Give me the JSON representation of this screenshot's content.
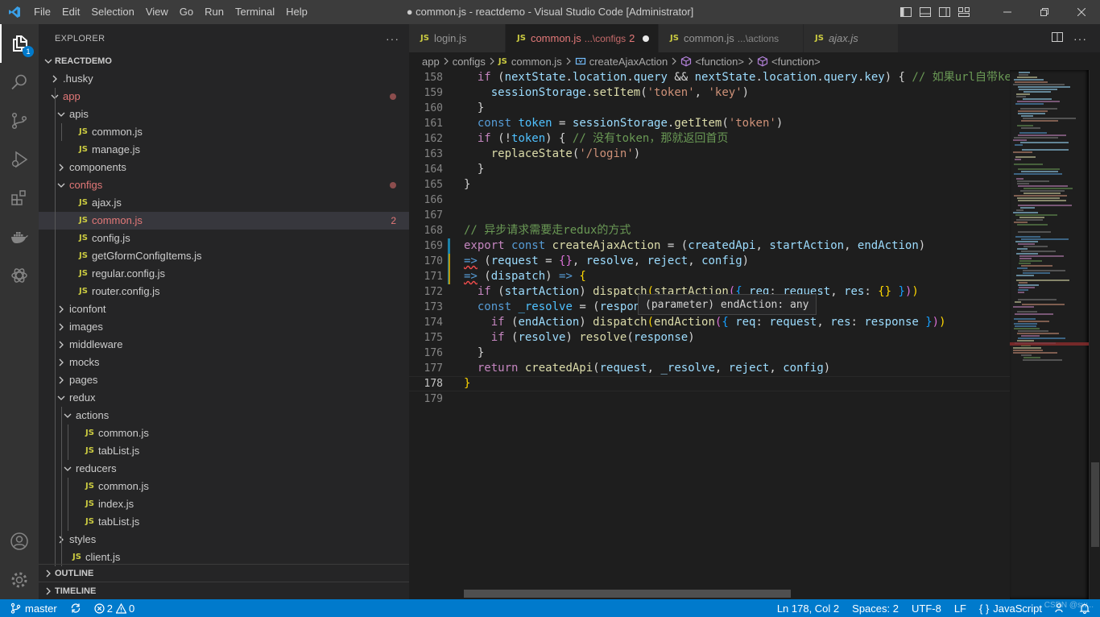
{
  "window": {
    "title": "● common.js - reactdemo - Visual Studio Code [Administrator]",
    "menu": [
      "File",
      "Edit",
      "Selection",
      "View",
      "Go",
      "Run",
      "Terminal",
      "Help"
    ]
  },
  "activity": {
    "explorer_badge": "1",
    "icons": [
      "files-icon",
      "search-icon",
      "source-control-icon",
      "run-debug-icon",
      "extensions-icon",
      "docker-icon",
      "openai-icon"
    ],
    "bottom_icons": [
      "account-icon",
      "settings-gear-icon"
    ]
  },
  "sidebar": {
    "header": "EXPLORER",
    "more": "···",
    "root": "REACTDEMO",
    "tree": [
      {
        "label": ".husky",
        "type": "folder",
        "open": false,
        "depth": 1
      },
      {
        "label": "app",
        "type": "folder",
        "open": true,
        "depth": 1,
        "modified": true
      },
      {
        "label": "apis",
        "type": "folder",
        "open": true,
        "depth": 2
      },
      {
        "label": "common.js",
        "type": "file",
        "depth": 3
      },
      {
        "label": "manage.js",
        "type": "file",
        "depth": 3
      },
      {
        "label": "components",
        "type": "folder",
        "open": false,
        "depth": 2
      },
      {
        "label": "configs",
        "type": "folder",
        "open": true,
        "depth": 2,
        "modified": true
      },
      {
        "label": "ajax.js",
        "type": "file",
        "depth": 3
      },
      {
        "label": "common.js",
        "type": "file",
        "depth": 3,
        "selected": true,
        "problems": "2"
      },
      {
        "label": "config.js",
        "type": "file",
        "depth": 3
      },
      {
        "label": "getGformConfigItems.js",
        "type": "file",
        "depth": 3
      },
      {
        "label": "regular.config.js",
        "type": "file",
        "depth": 3
      },
      {
        "label": "router.config.js",
        "type": "file",
        "depth": 3
      },
      {
        "label": "iconfont",
        "type": "folder",
        "open": false,
        "depth": 2
      },
      {
        "label": "images",
        "type": "folder",
        "open": false,
        "depth": 2
      },
      {
        "label": "middleware",
        "type": "folder",
        "open": false,
        "depth": 2
      },
      {
        "label": "mocks",
        "type": "folder",
        "open": false,
        "depth": 2
      },
      {
        "label": "pages",
        "type": "folder",
        "open": false,
        "depth": 2
      },
      {
        "label": "redux",
        "type": "folder",
        "open": true,
        "depth": 2
      },
      {
        "label": "actions",
        "type": "folder",
        "open": true,
        "depth": 3
      },
      {
        "label": "common.js",
        "type": "file",
        "depth": 4
      },
      {
        "label": "tabList.js",
        "type": "file",
        "depth": 4
      },
      {
        "label": "reducers",
        "type": "folder",
        "open": true,
        "depth": 3
      },
      {
        "label": "common.js",
        "type": "file",
        "depth": 4
      },
      {
        "label": "index.js",
        "type": "file",
        "depth": 4
      },
      {
        "label": "tabList.js",
        "type": "file",
        "depth": 4
      },
      {
        "label": "styles",
        "type": "folder",
        "open": false,
        "depth": 2
      },
      {
        "label": "client.js",
        "type": "file",
        "depth": 2
      }
    ],
    "file_icon_text": "JS",
    "outline": "OUTLINE",
    "timeline": "TIMELINE"
  },
  "tabs": [
    {
      "name": "login.js",
      "desc": "",
      "count": "",
      "active": false,
      "dirty": false,
      "italic": false
    },
    {
      "name": "common.js",
      "desc": "...\\configs",
      "count": "2",
      "active": true,
      "dirty": true,
      "italic": false
    },
    {
      "name": "common.js",
      "desc": "...\\actions",
      "count": "",
      "active": false,
      "dirty": false,
      "italic": false
    },
    {
      "name": "ajax.js",
      "desc": "",
      "count": "",
      "active": false,
      "dirty": false,
      "italic": true
    }
  ],
  "breadcrumb": {
    "items": [
      "app",
      "configs",
      "common.js",
      "createAjaxAction",
      "<function>",
      "<function>"
    ]
  },
  "editor": {
    "current_line": "178",
    "hover": "(parameter) endAction: any",
    "lines": [
      {
        "n": "158",
        "tokens": [
          [
            "  ",
            ""
          ],
          [
            "if",
            "k"
          ],
          [
            " (",
            ""
          ],
          [
            "nextState",
            "v"
          ],
          [
            ".",
            ""
          ],
          [
            "location",
            "v"
          ],
          [
            ".",
            ""
          ],
          [
            "query",
            "v"
          ],
          [
            " && ",
            ""
          ],
          [
            "nextState",
            "v"
          ],
          [
            ".",
            ""
          ],
          [
            "location",
            "v"
          ],
          [
            ".",
            ""
          ],
          [
            "query",
            "v"
          ],
          [
            ".",
            ""
          ],
          [
            "key",
            "v"
          ],
          [
            ") { ",
            ""
          ],
          [
            "// 如果url自带key",
            "cm"
          ]
        ]
      },
      {
        "n": "159",
        "tokens": [
          [
            "    ",
            ""
          ],
          [
            "sessionStorage",
            "v"
          ],
          [
            ".",
            ""
          ],
          [
            "setItem",
            "fn"
          ],
          [
            "(",
            ""
          ],
          [
            "'token'",
            "s"
          ],
          [
            ", ",
            ""
          ],
          [
            "'key'",
            "s"
          ],
          [
            ")",
            ""
          ]
        ]
      },
      {
        "n": "160",
        "tokens": [
          [
            "  }",
            ""
          ]
        ]
      },
      {
        "n": "161",
        "tokens": [
          [
            "  ",
            ""
          ],
          [
            "const",
            "kb"
          ],
          [
            " ",
            ""
          ],
          [
            "token",
            "c"
          ],
          [
            " = ",
            ""
          ],
          [
            "sessionStorage",
            "v"
          ],
          [
            ".",
            ""
          ],
          [
            "getItem",
            "fn"
          ],
          [
            "(",
            ""
          ],
          [
            "'token'",
            "s"
          ],
          [
            ")",
            ""
          ]
        ]
      },
      {
        "n": "162",
        "tokens": [
          [
            "  ",
            ""
          ],
          [
            "if",
            "k"
          ],
          [
            " (!",
            ""
          ],
          [
            "token",
            "c"
          ],
          [
            ") { ",
            ""
          ],
          [
            "// 没有token，那就返回首页",
            "cm"
          ]
        ]
      },
      {
        "n": "163",
        "tokens": [
          [
            "    ",
            ""
          ],
          [
            "replaceState",
            "fn"
          ],
          [
            "(",
            ""
          ],
          [
            "'/login'",
            "s"
          ],
          [
            ")",
            ""
          ]
        ]
      },
      {
        "n": "164",
        "tokens": [
          [
            "  }",
            ""
          ]
        ]
      },
      {
        "n": "165",
        "tokens": [
          [
            "}",
            ""
          ]
        ]
      },
      {
        "n": "166",
        "tokens": []
      },
      {
        "n": "167",
        "tokens": []
      },
      {
        "n": "168",
        "tokens": [
          [
            "// 异步请求需要走redux的方式",
            "cm"
          ]
        ]
      },
      {
        "n": "169",
        "tokens": [
          [
            "export",
            "k"
          ],
          [
            " ",
            ""
          ],
          [
            "const",
            "kb"
          ],
          [
            " ",
            ""
          ],
          [
            "createAjaxAction",
            "fn"
          ],
          [
            " = (",
            ""
          ],
          [
            "createdApi",
            "v"
          ],
          [
            ", ",
            ""
          ],
          [
            "startAction",
            "v"
          ],
          [
            ", ",
            ""
          ],
          [
            "endAction",
            "v"
          ],
          [
            ")",
            ""
          ]
        ]
      },
      {
        "n": "170",
        "tokens": [
          [
            "=>",
            "kbsq"
          ],
          [
            " (",
            ""
          ],
          [
            "request",
            "v"
          ],
          [
            " = ",
            ""
          ],
          [
            "{}",
            "bracket2"
          ],
          [
            ", ",
            ""
          ],
          [
            "resolve",
            "v"
          ],
          [
            ", ",
            ""
          ],
          [
            "reject",
            "v"
          ],
          [
            ", ",
            ""
          ],
          [
            "config",
            "v"
          ],
          [
            ")",
            ""
          ]
        ]
      },
      {
        "n": "171",
        "tokens": [
          [
            "=>",
            "kbsq"
          ],
          [
            " (",
            ""
          ],
          [
            "dispatch",
            "v"
          ],
          [
            ") ",
            ""
          ],
          [
            "=>",
            "kb"
          ],
          [
            " ",
            ""
          ],
          [
            "{",
            "bracket"
          ]
        ]
      },
      {
        "n": "172",
        "tokens": [
          [
            "  ",
            ""
          ],
          [
            "if",
            "k"
          ],
          [
            " (",
            ""
          ],
          [
            "startAction",
            "v"
          ],
          [
            ") ",
            ""
          ],
          [
            "dispatch",
            "fn"
          ],
          [
            "(",
            "bracket"
          ],
          [
            "startAction",
            "fn"
          ],
          [
            "(",
            "bracket2"
          ],
          [
            "{ ",
            "bracket3"
          ],
          [
            "req",
            "v"
          ],
          [
            ": ",
            ""
          ],
          [
            "request",
            "v"
          ],
          [
            ", ",
            ""
          ],
          [
            "res",
            "v"
          ],
          [
            ": ",
            ""
          ],
          [
            "{}",
            "bracket"
          ],
          [
            " }",
            "bracket3"
          ],
          [
            ")",
            "bracket2"
          ],
          [
            ")",
            "bracket"
          ]
        ]
      },
      {
        "n": "173",
        "tokens": [
          [
            "  ",
            ""
          ],
          [
            "const",
            "kb"
          ],
          [
            " ",
            ""
          ],
          [
            "_resolve",
            "c"
          ],
          [
            " = (",
            ""
          ],
          [
            "response",
            "v"
          ],
          [
            ") ",
            ""
          ],
          [
            "=>",
            "kb"
          ],
          [
            " {",
            ""
          ]
        ]
      },
      {
        "n": "174",
        "tokens": [
          [
            "    ",
            ""
          ],
          [
            "if",
            "k"
          ],
          [
            " (",
            ""
          ],
          [
            "endAction",
            "v"
          ],
          [
            ") ",
            ""
          ],
          [
            "dispatch",
            "fn"
          ],
          [
            "(",
            "bracket"
          ],
          [
            "endAction",
            "fn"
          ],
          [
            "(",
            "bracket2"
          ],
          [
            "{ ",
            "bracket3"
          ],
          [
            "req",
            "v"
          ],
          [
            ": ",
            ""
          ],
          [
            "request",
            "v"
          ],
          [
            ", ",
            ""
          ],
          [
            "res",
            "v"
          ],
          [
            ": ",
            ""
          ],
          [
            "response",
            "v"
          ],
          [
            " }",
            "bracket3"
          ],
          [
            ")",
            "bracket2"
          ],
          [
            ")",
            "bracket"
          ]
        ]
      },
      {
        "n": "175",
        "tokens": [
          [
            "    ",
            ""
          ],
          [
            "if",
            "k"
          ],
          [
            " (",
            ""
          ],
          [
            "resolve",
            "v"
          ],
          [
            ") ",
            ""
          ],
          [
            "resolve",
            "fn"
          ],
          [
            "(",
            ""
          ],
          [
            "response",
            "v"
          ],
          [
            ")",
            ""
          ]
        ]
      },
      {
        "n": "176",
        "tokens": [
          [
            "  }",
            ""
          ]
        ]
      },
      {
        "n": "177",
        "tokens": [
          [
            "  ",
            ""
          ],
          [
            "return",
            "k"
          ],
          [
            " ",
            ""
          ],
          [
            "createdApi",
            "fn"
          ],
          [
            "(",
            ""
          ],
          [
            "request",
            "v"
          ],
          [
            ", ",
            ""
          ],
          [
            "_resolve",
            "v"
          ],
          [
            ", ",
            ""
          ],
          [
            "reject",
            "v"
          ],
          [
            ", ",
            ""
          ],
          [
            "config",
            "v"
          ],
          [
            ")",
            ""
          ]
        ]
      },
      {
        "n": "178",
        "tokens": [
          [
            "}",
            "bracket"
          ]
        ]
      },
      {
        "n": "179",
        "tokens": []
      }
    ]
  },
  "statusbar": {
    "branch": "master",
    "errors": "2",
    "warnings": "0",
    "position": "Ln 178, Col 2",
    "spaces": "Spaces: 2",
    "encoding": "UTF-8",
    "eol": "LF",
    "language": "JavaScript",
    "watermark": "CSDN @sw..."
  },
  "colors": {
    "accent": "#007acc",
    "modified": "#e37878",
    "js_icon": "#cbcb41"
  }
}
